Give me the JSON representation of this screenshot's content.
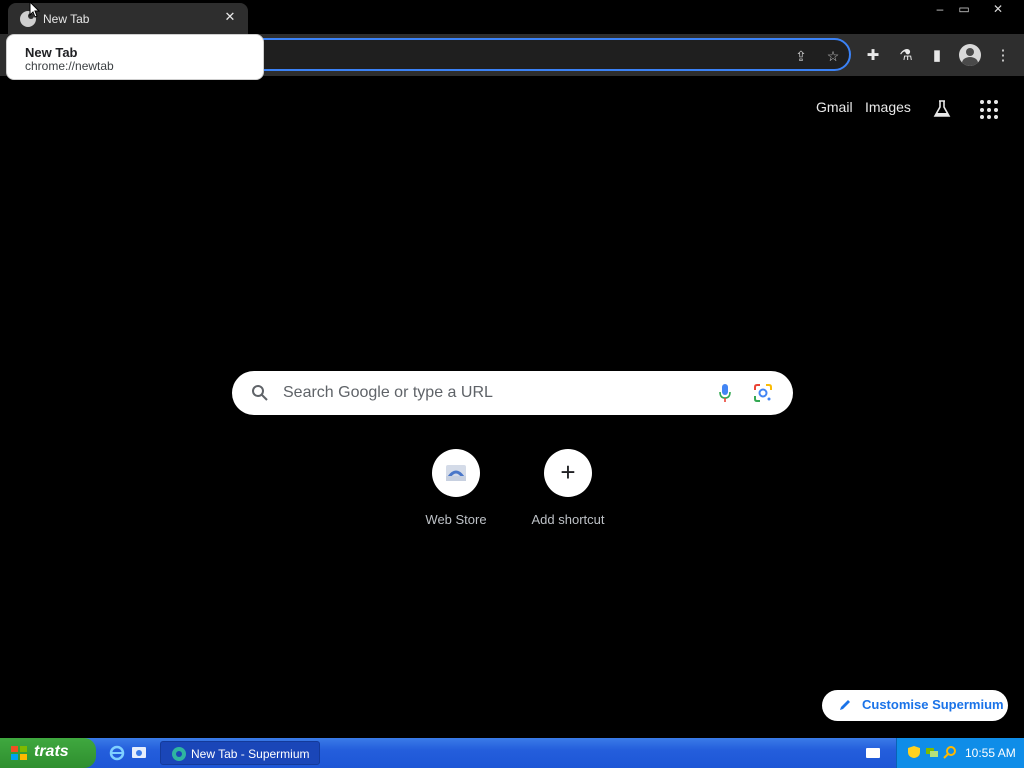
{
  "window": {
    "tab_title": "New Tab",
    "controls": {
      "minimize": "–",
      "restore": "▭",
      "close": "✕"
    }
  },
  "hover_card": {
    "title": "New Tab",
    "url": "chrome://newtab"
  },
  "ntp": {
    "links": {
      "gmail": "Gmail",
      "images": "Images"
    },
    "search_placeholder": "Search Google or type a URL",
    "shortcuts": [
      {
        "label": "Web Store",
        "icon": "web-store-icon"
      },
      {
        "label": "Add shortcut",
        "icon": "plus-icon"
      }
    ],
    "customise_label": "Customise Supermium"
  },
  "taskbar": {
    "start_label": "trats",
    "task_label": "New Tab - Supermium",
    "clock": "10:55 AM"
  },
  "colors": {
    "accent": "#3b82f6",
    "background": "#000000",
    "taskbar": "#245edc",
    "start": "#2f8f2f"
  }
}
